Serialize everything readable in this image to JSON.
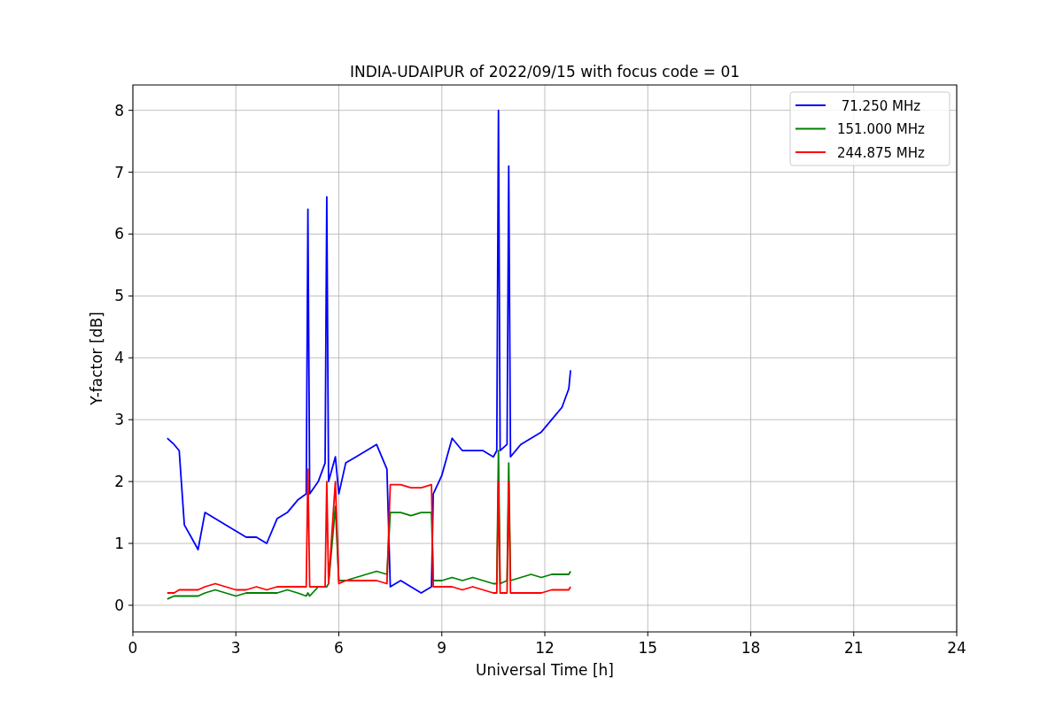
{
  "chart": {
    "chart_data": {
      "type": "line",
      "title": "INDIA-UDAIPUR of 2022/09/15 with focus code = 01",
      "xlabel": "Universal Time [h]",
      "ylabel": "Y-factor [dB]",
      "x": [
        1.0,
        1.2,
        1.35,
        1.5,
        1.7,
        1.9,
        2.1,
        2.4,
        2.7,
        3.0,
        3.3,
        3.6,
        3.9,
        4.2,
        4.5,
        4.8,
        5.05,
        5.1,
        5.15,
        5.4,
        5.6,
        5.65,
        5.7,
        5.9,
        6.0,
        6.2,
        6.5,
        6.8,
        7.1,
        7.4,
        7.5,
        7.8,
        8.1,
        8.4,
        8.7,
        8.75,
        9.0,
        9.3,
        9.6,
        9.9,
        10.2,
        10.5,
        10.6,
        10.65,
        10.7,
        10.9,
        10.95,
        11.0,
        11.3,
        11.6,
        11.9,
        12.2,
        12.5,
        12.7,
        12.75
      ],
      "series": [
        {
          "name": " 71.250 MHz",
          "color": "#0000ff",
          "values": [
            2.7,
            2.6,
            2.5,
            1.3,
            1.1,
            0.9,
            1.5,
            1.4,
            1.3,
            1.2,
            1.1,
            1.1,
            1.0,
            1.4,
            1.5,
            1.7,
            1.8,
            6.4,
            1.8,
            2.0,
            2.3,
            6.6,
            2.0,
            2.4,
            1.8,
            2.3,
            2.4,
            2.5,
            2.6,
            2.2,
            0.3,
            0.4,
            0.3,
            0.2,
            0.3,
            1.8,
            2.1,
            2.7,
            2.5,
            2.5,
            2.5,
            2.4,
            2.5,
            8.0,
            2.5,
            2.6,
            7.1,
            2.4,
            2.6,
            2.7,
            2.8,
            3.0,
            3.2,
            3.5,
            3.8
          ]
        },
        {
          "name": "151.000 MHz",
          "color": "#008000",
          "values": [
            0.1,
            0.15,
            0.15,
            0.15,
            0.15,
            0.15,
            0.2,
            0.25,
            0.2,
            0.15,
            0.2,
            0.2,
            0.2,
            0.2,
            0.25,
            0.2,
            0.15,
            0.2,
            0.15,
            0.3,
            0.3,
            0.3,
            0.35,
            1.6,
            0.4,
            0.4,
            0.45,
            0.5,
            0.55,
            0.5,
            1.5,
            1.5,
            1.45,
            1.5,
            1.5,
            0.4,
            0.4,
            0.45,
            0.4,
            0.45,
            0.4,
            0.35,
            0.35,
            2.5,
            0.35,
            0.4,
            2.3,
            0.4,
            0.45,
            0.5,
            0.45,
            0.5,
            0.5,
            0.5,
            0.55
          ]
        },
        {
          "name": "244.875 MHz",
          "color": "#ff0000",
          "values": [
            0.2,
            0.2,
            0.25,
            0.25,
            0.25,
            0.25,
            0.3,
            0.35,
            0.3,
            0.25,
            0.25,
            0.3,
            0.25,
            0.3,
            0.3,
            0.3,
            0.3,
            2.2,
            0.3,
            0.3,
            0.3,
            2.0,
            0.35,
            2.0,
            0.35,
            0.4,
            0.4,
            0.4,
            0.4,
            0.35,
            1.95,
            1.95,
            1.9,
            1.9,
            1.95,
            0.3,
            0.3,
            0.3,
            0.25,
            0.3,
            0.25,
            0.2,
            0.2,
            2.0,
            0.2,
            0.2,
            2.0,
            0.2,
            0.2,
            0.2,
            0.2,
            0.25,
            0.25,
            0.25,
            0.3
          ]
        }
      ],
      "grid": true,
      "legend": true,
      "xlim": [
        0,
        24
      ],
      "ylim": [
        -0.43,
        8.41
      ],
      "xticks": [
        0,
        3,
        6,
        9,
        12,
        15,
        18,
        21,
        24
      ],
      "yticks": [
        0,
        1,
        2,
        3,
        4,
        5,
        6,
        7,
        8
      ]
    }
  }
}
